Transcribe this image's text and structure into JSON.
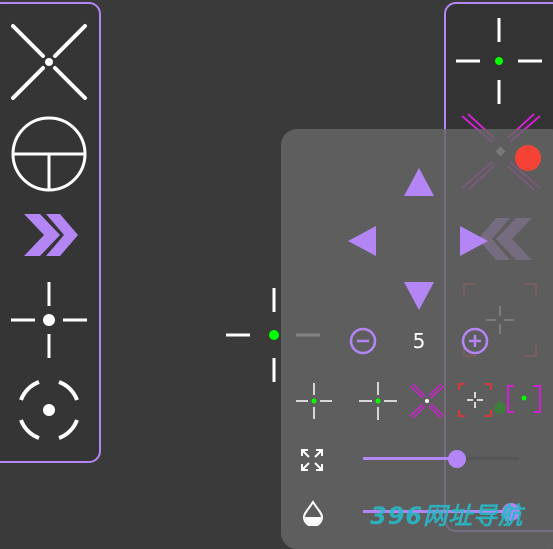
{
  "accent_color": "#b485f5",
  "crosshair_dot_color": "#00ff00",
  "record_dot_color": "#f44336",
  "left_panel": {
    "items": [
      "x-cross-icon",
      "scope-circle-icon",
      "chevron-right-double-icon",
      "dot-cross-icon",
      "ring-dot-icon"
    ]
  },
  "right_panel": {
    "items": [
      "green-dot-cross-icon",
      "magenta-x-cross-icon",
      "chevron-left-double-icon",
      "bracket-cross-icon"
    ]
  },
  "settings": {
    "size_value": "5",
    "size_slider_level": 0.6,
    "opacity_slider_level": 0.95,
    "style_options": [
      "green-cross-small-icon",
      "green-cross-icon",
      "magenta-x-icon",
      "red-bracket-icon",
      "bracket-green-dot-icon"
    ]
  },
  "watermark_text": "396网址导航"
}
